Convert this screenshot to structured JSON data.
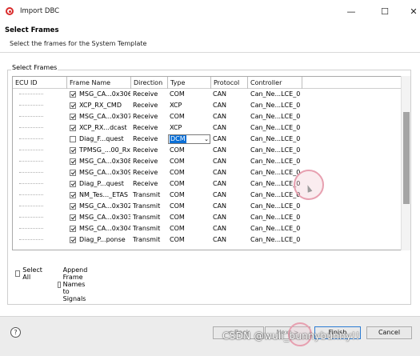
{
  "window": {
    "title": "Import DBC",
    "minimize_glyph": "—",
    "maximize_glyph": "☐",
    "close_glyph": "✕"
  },
  "header": {
    "title": "Select Frames",
    "description": "Select the frames for the System Template"
  },
  "group": {
    "label": "Select Frames"
  },
  "table": {
    "columns": [
      "ECU ID",
      "Frame Name",
      "Direction",
      "Type",
      "Protocol",
      "Controller"
    ],
    "rows": [
      {
        "checked": true,
        "name": "MSG_CA...0x306",
        "direction": "Receive",
        "type": "COM",
        "protocol": "CAN",
        "controller": "Can_Ne...LCE_0"
      },
      {
        "checked": true,
        "name": "XCP_RX_CMD",
        "direction": "Receive",
        "type": "XCP",
        "protocol": "CAN",
        "controller": "Can_Ne...LCE_0"
      },
      {
        "checked": true,
        "name": "MSG_CA...0x307",
        "direction": "Receive",
        "type": "COM",
        "protocol": "CAN",
        "controller": "Can_Ne...LCE_0"
      },
      {
        "checked": true,
        "name": "XCP_RX...dcast",
        "direction": "Receive",
        "type": "XCP",
        "protocol": "CAN",
        "controller": "Can_Ne...LCE_0"
      },
      {
        "checked": false,
        "name": "Diag_F...quest",
        "direction": "Receive",
        "type": "DCM",
        "protocol": "CAN",
        "controller": "Can_Ne...LCE_0",
        "editing": true
      },
      {
        "checked": true,
        "name": "TPMSG_...00_Rx",
        "direction": "Receive",
        "type": "COM",
        "protocol": "CAN",
        "controller": "Can_Ne...LCE_0"
      },
      {
        "checked": true,
        "name": "MSG_CA...0x308",
        "direction": "Receive",
        "type": "COM",
        "protocol": "CAN",
        "controller": "Can_Ne...LCE_0"
      },
      {
        "checked": true,
        "name": "MSG_CA...0x309",
        "direction": "Receive",
        "type": "COM",
        "protocol": "CAN",
        "controller": "Can_Ne...LCE_0"
      },
      {
        "checked": true,
        "name": "Diag_P...quest",
        "direction": "Receive",
        "type": "COM",
        "protocol": "CAN",
        "controller": "Can_Ne...LCE_0"
      },
      {
        "checked": true,
        "name": "NM_Tes..._ETAS",
        "direction": "Transmit",
        "type": "COM",
        "protocol": "CAN",
        "controller": "Can_Ne...LCE_0"
      },
      {
        "checked": true,
        "name": "MSG_CA...0x302",
        "direction": "Transmit",
        "type": "COM",
        "protocol": "CAN",
        "controller": "Can_Ne...LCE_0"
      },
      {
        "checked": true,
        "name": "MSG_CA...0x303",
        "direction": "Transmit",
        "type": "COM",
        "protocol": "CAN",
        "controller": "Can_Ne...LCE_0"
      },
      {
        "checked": true,
        "name": "MSG_CA...0x304",
        "direction": "Transmit",
        "type": "COM",
        "protocol": "CAN",
        "controller": "Can_Ne...LCE_0"
      },
      {
        "checked": true,
        "name": "Diag_P...ponse",
        "direction": "Transmit",
        "type": "COM",
        "protocol": "CAN",
        "controller": "Can_Ne...LCE_0"
      }
    ]
  },
  "options": {
    "select_all": "Select All",
    "append_names": "Append Frame Names to Signals"
  },
  "footer": {
    "help_glyph": "?",
    "back": "< Back",
    "next": "Next >",
    "finish": "Finish",
    "cancel": "Cancel"
  },
  "watermark": "CSDN @wuli_bunnybunny!!"
}
